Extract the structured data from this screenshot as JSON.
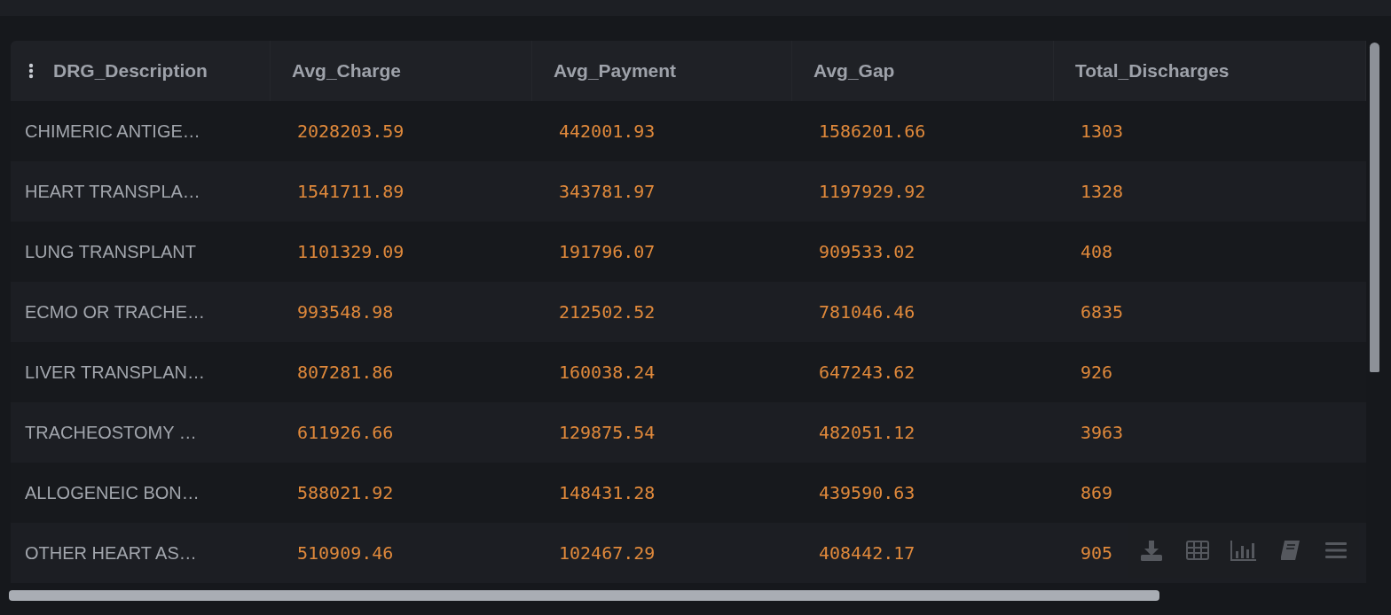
{
  "table": {
    "columns": [
      "DRG_Description",
      "Avg_Charge",
      "Avg_Payment",
      "Avg_Gap",
      "Total_Discharges"
    ],
    "rows": [
      [
        "CHIMERIC ANTIGE…",
        "2028203.59",
        "442001.93",
        "1586201.66",
        "1303"
      ],
      [
        "HEART TRANSPLA…",
        "1541711.89",
        "343781.97",
        "1197929.92",
        "1328"
      ],
      [
        "LUNG TRANSPLANT",
        "1101329.09",
        "191796.07",
        "909533.02",
        "408"
      ],
      [
        "ECMO OR TRACHE…",
        "993548.98",
        "212502.52",
        "781046.46",
        "6835"
      ],
      [
        "LIVER TRANSPLAN…",
        "807281.86",
        "160038.24",
        "647243.62",
        "926"
      ],
      [
        "TRACHEOSTOMY …",
        "611926.66",
        "129875.54",
        "482051.12",
        "3963"
      ],
      [
        "ALLOGENEIC BON…",
        "588021.92",
        "148431.28",
        "439590.63",
        "869"
      ],
      [
        "OTHER HEART AS…",
        "510909.46",
        "102467.29",
        "408442.17",
        "905"
      ]
    ]
  },
  "toolbar": [
    {
      "kind": "download"
    },
    {
      "kind": "table"
    },
    {
      "kind": "chart"
    },
    {
      "kind": "book"
    },
    {
      "kind": "menu"
    }
  ]
}
